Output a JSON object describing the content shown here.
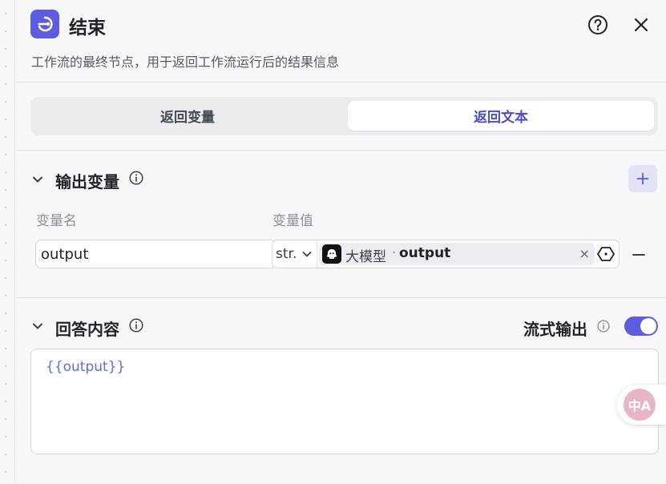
{
  "node": {
    "title": "结束",
    "description": "工作流的最终节点，用于返回工作流运行后的结果信息",
    "icon": "end-node-icon",
    "accent_color": "#5d5cde"
  },
  "header_actions": {
    "help_icon": "help-circle-icon",
    "close_icon": "close-icon"
  },
  "mode_tabs": {
    "items": [
      {
        "label": "返回变量",
        "selected": false
      },
      {
        "label": "返回文本",
        "selected": true
      }
    ]
  },
  "output_section": {
    "title": "输出变量",
    "col_name": "变量名",
    "col_value": "变量值",
    "rows": [
      {
        "name": "output",
        "type": "str.",
        "ref_node": "大模型",
        "ref_separator": "·",
        "ref_var": "output",
        "clear": "×"
      }
    ]
  },
  "answer_section": {
    "title": "回答内容",
    "stream_label": "流式输出",
    "stream_on": true,
    "content": "{{output}}"
  },
  "floating": {
    "translate_label": "中A"
  }
}
